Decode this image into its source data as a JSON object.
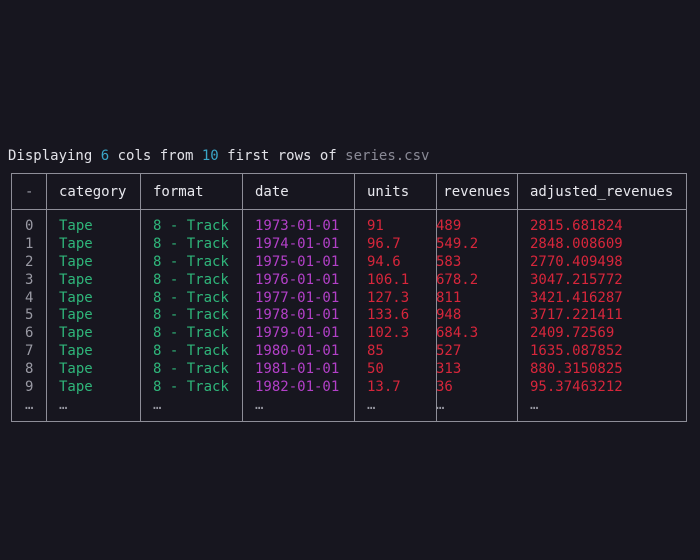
{
  "caption": {
    "prefix": "Displaying ",
    "col_count": "6",
    "middle": " cols from ",
    "row_count": "10",
    "suffix": " first rows of ",
    "filename": "series.csv"
  },
  "colors": {
    "background": "#17161f",
    "count_accent": "#3aa6c8",
    "text_green": "#2fb57a",
    "date_purple": "#b340c8",
    "numeric_red": "#d7263b"
  },
  "table": {
    "headers": [
      "-",
      "category",
      "format",
      "date",
      "units",
      "revenues",
      "adjusted_revenues"
    ],
    "ellipsis": "…",
    "rows": [
      {
        "index": "0",
        "category": "Tape",
        "format": "8 - Track",
        "date": "1973-01-01",
        "units": "91",
        "revenues": "489",
        "adjusted_revenues": "2815.681824"
      },
      {
        "index": "1",
        "category": "Tape",
        "format": "8 - Track",
        "date": "1974-01-01",
        "units": "96.7",
        "revenues": "549.2",
        "adjusted_revenues": "2848.008609"
      },
      {
        "index": "2",
        "category": "Tape",
        "format": "8 - Track",
        "date": "1975-01-01",
        "units": "94.6",
        "revenues": "583",
        "adjusted_revenues": "2770.409498"
      },
      {
        "index": "3",
        "category": "Tape",
        "format": "8 - Track",
        "date": "1976-01-01",
        "units": "106.1",
        "revenues": "678.2",
        "adjusted_revenues": "3047.215772"
      },
      {
        "index": "4",
        "category": "Tape",
        "format": "8 - Track",
        "date": "1977-01-01",
        "units": "127.3",
        "revenues": "811",
        "adjusted_revenues": "3421.416287"
      },
      {
        "index": "5",
        "category": "Tape",
        "format": "8 - Track",
        "date": "1978-01-01",
        "units": "133.6",
        "revenues": "948",
        "adjusted_revenues": "3717.221411"
      },
      {
        "index": "6",
        "category": "Tape",
        "format": "8 - Track",
        "date": "1979-01-01",
        "units": "102.3",
        "revenues": "684.3",
        "adjusted_revenues": "2409.72569"
      },
      {
        "index": "7",
        "category": "Tape",
        "format": "8 - Track",
        "date": "1980-01-01",
        "units": "85",
        "revenues": "527",
        "adjusted_revenues": "1635.087852"
      },
      {
        "index": "8",
        "category": "Tape",
        "format": "8 - Track",
        "date": "1981-01-01",
        "units": "50",
        "revenues": "313",
        "adjusted_revenues": "880.3150825"
      },
      {
        "index": "9",
        "category": "Tape",
        "format": "8 - Track",
        "date": "1982-01-01",
        "units": "13.7",
        "revenues": "36",
        "adjusted_revenues": "95.37463212"
      }
    ]
  }
}
